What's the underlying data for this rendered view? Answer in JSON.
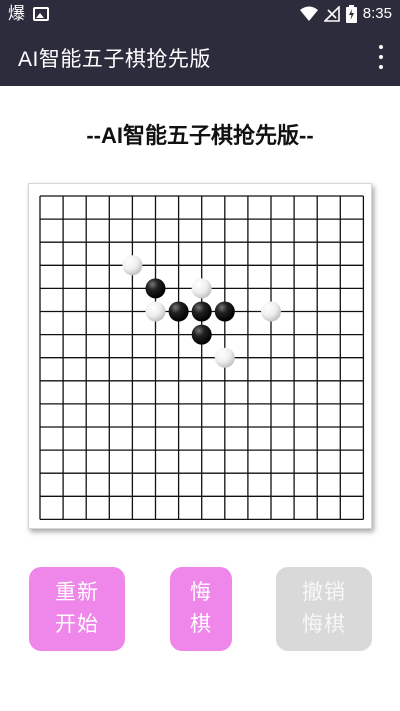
{
  "status_bar": {
    "time": "8:35",
    "left_icons": [
      "baozi-glyph",
      "image-icon"
    ],
    "baozi_glyph": "爆",
    "right_icons": [
      "wifi-icon",
      "no-signal-icon",
      "battery-charging-icon"
    ]
  },
  "app_bar": {
    "title": "AI智能五子棋抢先版",
    "menu_icon": "more-vert-icon"
  },
  "page": {
    "heading": "--AI智能五子棋抢先版--"
  },
  "board": {
    "lines": 15,
    "stones": [
      {
        "col": 4,
        "row": 3,
        "color": "white"
      },
      {
        "col": 5,
        "row": 4,
        "color": "black"
      },
      {
        "col": 7,
        "row": 4,
        "color": "white"
      },
      {
        "col": 5,
        "row": 5,
        "color": "white"
      },
      {
        "col": 6,
        "row": 5,
        "color": "black"
      },
      {
        "col": 7,
        "row": 5,
        "color": "black"
      },
      {
        "col": 8,
        "row": 5,
        "color": "black"
      },
      {
        "col": 10,
        "row": 5,
        "color": "white"
      },
      {
        "col": 7,
        "row": 6,
        "color": "black"
      },
      {
        "col": 8,
        "row": 7,
        "color": "white"
      }
    ]
  },
  "buttons": {
    "restart": {
      "line1": "重新",
      "line2": "开始"
    },
    "undo": {
      "line1": "悔",
      "line2": "棋"
    },
    "redo": {
      "line1": "撤销",
      "line2": "悔棋"
    }
  },
  "colors": {
    "bar": "#2c2c3c",
    "button_active": "#ef86e9",
    "button_disabled": "#d9d9d9"
  }
}
